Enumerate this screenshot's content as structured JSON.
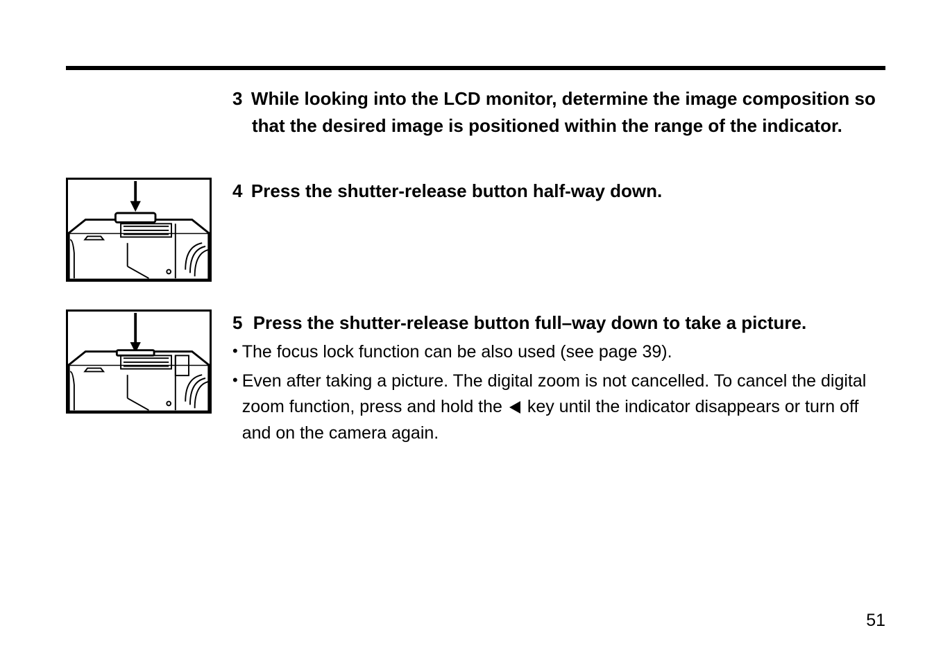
{
  "page_number": "51",
  "step3": {
    "number": "3",
    "heading": "While looking into the LCD monitor, determine the image composition so that the desired image is positioned within the range of the indicator."
  },
  "step4": {
    "number": "4",
    "heading": "Press the shutter-release button half-way down."
  },
  "step5": {
    "number": "5",
    "heading": " Press the shutter-release button full–way down to take a picture.",
    "bullet1": "The focus lock function can be also used (see page 39).",
    "bullet2_a": " Even after taking a picture. The digital zoom is not cancelled. To cancel the digital zoom function, press and hold the ",
    "bullet2_b": " key until the indicator disappears or turn off and on the camera again."
  }
}
